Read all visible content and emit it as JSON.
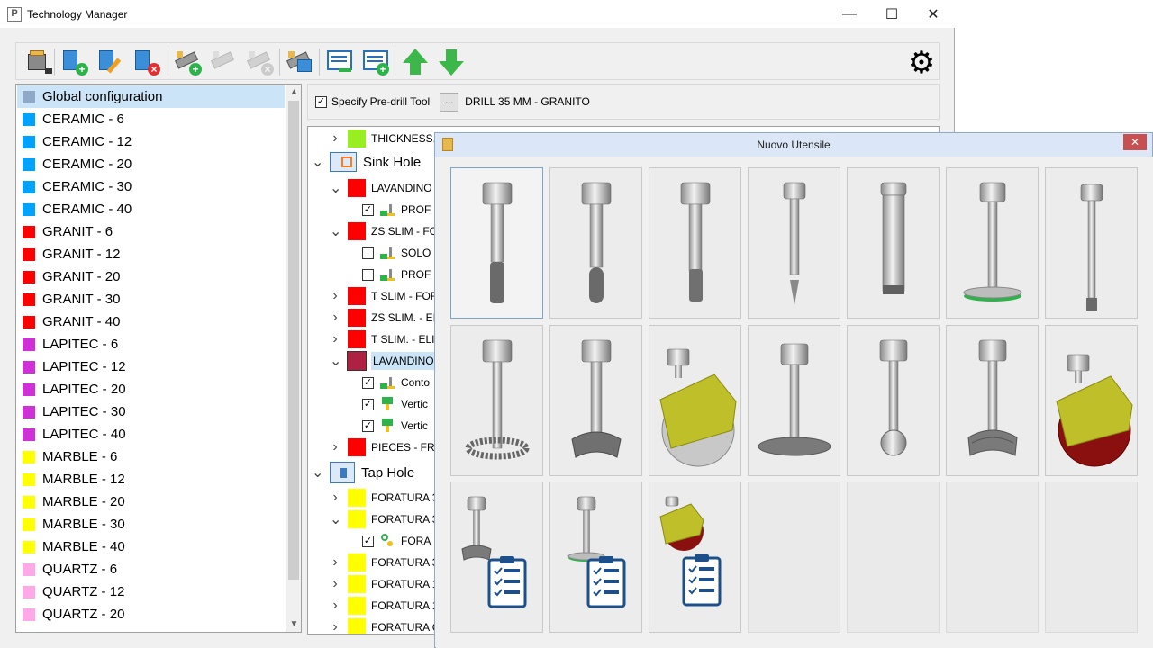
{
  "window": {
    "title": "Technology Manager",
    "app_icon_text": "P",
    "minimize_glyph": "—",
    "maximize_glyph": "☐",
    "close_glyph": "✕"
  },
  "toolbar": {
    "settings_glyph": "⚙",
    "buttons": [
      {
        "name": "database-menu-icon",
        "enabled": true
      },
      {
        "name": "add-material-icon",
        "enabled": true
      },
      {
        "name": "edit-material-icon",
        "enabled": true
      },
      {
        "name": "delete-material-icon",
        "enabled": true
      },
      {
        "name": "add-tool-icon",
        "enabled": true
      },
      {
        "name": "edit-tool-icon",
        "enabled": false
      },
      {
        "name": "delete-tool-icon",
        "enabled": false
      },
      {
        "name": "copy-tool-icon",
        "enabled": true
      },
      {
        "name": "remove-row-icon",
        "enabled": true
      },
      {
        "name": "add-row-icon",
        "enabled": true
      },
      {
        "name": "move-up-icon",
        "enabled": true
      },
      {
        "name": "move-down-icon",
        "enabled": true
      }
    ]
  },
  "materials": [
    {
      "label": "Global configuration",
      "color": "#8fa8c8",
      "selected": true
    },
    {
      "label": "CERAMIC - 6",
      "color": "#00a2ff"
    },
    {
      "label": "CERAMIC - 12",
      "color": "#00a2ff"
    },
    {
      "label": "CERAMIC - 20",
      "color": "#00a2ff"
    },
    {
      "label": "CERAMIC - 30",
      "color": "#00a2ff"
    },
    {
      "label": "CERAMIC - 40",
      "color": "#00a2ff"
    },
    {
      "label": "GRANIT - 6",
      "color": "#ff0000"
    },
    {
      "label": "GRANIT - 12",
      "color": "#ff0000"
    },
    {
      "label": "GRANIT - 20",
      "color": "#ff0000"
    },
    {
      "label": "GRANIT - 30",
      "color": "#ff0000"
    },
    {
      "label": "GRANIT - 40",
      "color": "#ff0000"
    },
    {
      "label": "LAPITEC - 6",
      "color": "#d030d8"
    },
    {
      "label": "LAPITEC - 12",
      "color": "#d030d8"
    },
    {
      "label": "LAPITEC - 20",
      "color": "#d030d8"
    },
    {
      "label": "LAPITEC - 30",
      "color": "#d030d8"
    },
    {
      "label": "LAPITEC - 40",
      "color": "#d030d8"
    },
    {
      "label": "MARBLE - 6",
      "color": "#ffff00"
    },
    {
      "label": "MARBLE - 12",
      "color": "#ffff00"
    },
    {
      "label": "MARBLE - 20",
      "color": "#ffff00"
    },
    {
      "label": "MARBLE - 30",
      "color": "#ffff00"
    },
    {
      "label": "MARBLE - 40",
      "color": "#ffff00"
    },
    {
      "label": "QUARTZ - 6",
      "color": "#ffa8e8"
    },
    {
      "label": "QUARTZ - 12",
      "color": "#ffa8e8"
    },
    {
      "label": "QUARTZ - 20",
      "color": "#ffa8e8"
    }
  ],
  "predrill": {
    "label": "Specify Pre-drill Tool",
    "checked": true,
    "browse_label": "...",
    "value": "DRILL 35 MM - GRANITO"
  },
  "tree": [
    {
      "level": 1,
      "type": "tool",
      "chevron": "right",
      "color": "#99ee22",
      "label": "THICKNESS."
    },
    {
      "level": 0,
      "type": "category",
      "chevron": "down",
      "icon": "sink-hole-icon",
      "label": "Sink Hole"
    },
    {
      "level": 1,
      "type": "tool",
      "chevron": "down",
      "color": "#ff0000",
      "label": "LAVANDINO"
    },
    {
      "level": 2,
      "type": "op",
      "checked": true,
      "icon": "profile-op-icon",
      "label": "PROF"
    },
    {
      "level": 1,
      "type": "tool",
      "chevron": "down",
      "color": "#ff0000",
      "label": "ZS SLIM - FC"
    },
    {
      "level": 2,
      "type": "op",
      "checked": false,
      "icon": "profile-op-icon",
      "label": "SOLO"
    },
    {
      "level": 2,
      "type": "op",
      "checked": false,
      "icon": "profile-op-icon",
      "label": "PROF"
    },
    {
      "level": 1,
      "type": "tool",
      "chevron": "right",
      "color": "#ff0000",
      "label": "T SLIM - FOF"
    },
    {
      "level": 1,
      "type": "tool",
      "chevron": "right",
      "color": "#ff0000",
      "label": "ZS SLIM. - EI"
    },
    {
      "level": 1,
      "type": "tool",
      "chevron": "right",
      "color": "#ff0000",
      "label": "T SLIM. - ELI"
    },
    {
      "level": 1,
      "type": "tool",
      "chevron": "down",
      "color": "#b02040",
      "label": "LAVANDINO",
      "selected": true
    },
    {
      "level": 2,
      "type": "op",
      "checked": true,
      "icon": "contour-op-icon",
      "label": "Conto"
    },
    {
      "level": 2,
      "type": "op",
      "checked": true,
      "icon": "vertical-op-icon",
      "label": "Vertic"
    },
    {
      "level": 2,
      "type": "op",
      "checked": true,
      "icon": "vertical-op-icon",
      "label": "Vertic"
    },
    {
      "level": 1,
      "type": "tool",
      "chevron": "right",
      "color": "#ff0000",
      "label": "PIECES - FRO"
    },
    {
      "level": 0,
      "type": "category",
      "chevron": "down",
      "icon": "tap-hole-icon",
      "label": "Tap Hole"
    },
    {
      "level": 1,
      "type": "tool",
      "chevron": "right",
      "color": "#ffff00",
      "label": "FORATURA 3"
    },
    {
      "level": 1,
      "type": "tool",
      "chevron": "down",
      "color": "#ffff00",
      "label": "FORATURA 3"
    },
    {
      "level": 2,
      "type": "op",
      "checked": true,
      "icon": "drill-op-icon",
      "label": "FORA"
    },
    {
      "level": 1,
      "type": "tool",
      "chevron": "right",
      "color": "#ffff00",
      "label": "FORATURA 3"
    },
    {
      "level": 1,
      "type": "tool",
      "chevron": "right",
      "color": "#ffff00",
      "label": "FORATURA 1"
    },
    {
      "level": 1,
      "type": "tool",
      "chevron": "right",
      "color": "#ffff00",
      "label": "FORATURA 1"
    },
    {
      "level": 1,
      "type": "tool",
      "chevron": "right",
      "color": "#ffff00",
      "label": "FORATURA C"
    }
  ],
  "dialog": {
    "title": "Nuovo Utensile",
    "close_glyph": "✕",
    "tools": [
      {
        "name": "grinding-bit-icon",
        "kind": "grinder",
        "selected": true
      },
      {
        "name": "rounded-grinding-bit-icon",
        "kind": "grinder-round"
      },
      {
        "name": "short-grinding-bit-icon",
        "kind": "grinder-short"
      },
      {
        "name": "engraving-bit-icon",
        "kind": "engraver"
      },
      {
        "name": "core-drill-icon",
        "kind": "core-drill"
      },
      {
        "name": "peripheral-disc-icon",
        "kind": "peripheral"
      },
      {
        "name": "small-drill-icon",
        "kind": "small-drill"
      },
      {
        "name": "toothed-wheel-icon",
        "kind": "toothed"
      },
      {
        "name": "profile-wheel-icon",
        "kind": "profile-wheel"
      },
      {
        "name": "saw-blade-icon",
        "kind": "saw"
      },
      {
        "name": "flat-disc-icon",
        "kind": "flat-disc"
      },
      {
        "name": "ball-tool-icon",
        "kind": "ball"
      },
      {
        "name": "multi-profile-wheel-icon",
        "kind": "multi-profile"
      },
      {
        "name": "saw-blade-red-icon",
        "kind": "saw-red"
      },
      {
        "name": "profile-wheel-list-icon",
        "kind": "list-profile"
      },
      {
        "name": "peripheral-list-icon",
        "kind": "list-peripheral"
      },
      {
        "name": "saw-blade-list-icon",
        "kind": "list-saw"
      },
      {
        "name": "empty-slot",
        "kind": "empty"
      },
      {
        "name": "empty-slot",
        "kind": "empty"
      },
      {
        "name": "empty-slot",
        "kind": "empty"
      },
      {
        "name": "empty-slot",
        "kind": "empty"
      }
    ]
  }
}
